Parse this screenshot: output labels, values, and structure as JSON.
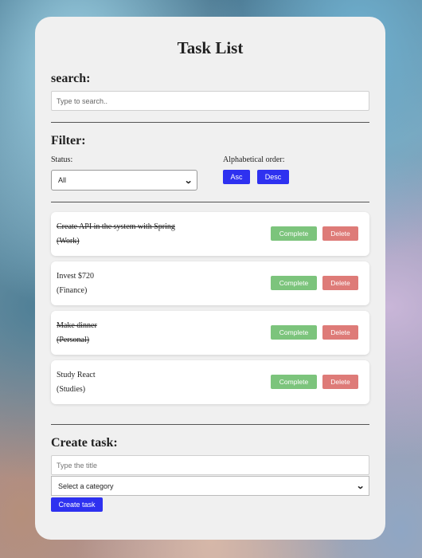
{
  "app": {
    "title": "Task List"
  },
  "search": {
    "heading": "search:",
    "placeholder": "Type to search.."
  },
  "filter": {
    "heading": "Filter:",
    "status_label": "Status:",
    "status_value": "All",
    "order_label": "Alphabetical order:",
    "asc_label": "Asc",
    "desc_label": "Desc"
  },
  "tasks": [
    {
      "title": "Create API in the system with Spring",
      "category": "(Work)",
      "completed": true
    },
    {
      "title": "Invest $720",
      "category": "(Finance)",
      "completed": false
    },
    {
      "title": "Make dinner",
      "category": "(Personal)",
      "completed": true
    },
    {
      "title": "Study React",
      "category": "(Studies)",
      "completed": false
    }
  ],
  "task_actions": {
    "complete_label": "Complete",
    "delete_label": "Delete"
  },
  "create": {
    "heading": "Create task:",
    "title_placeholder": "Type the title",
    "category_value": "Select a category",
    "button_label": "Create task"
  },
  "colors": {
    "primary_button": "#2e31f0",
    "complete_button": "#7cc47c",
    "delete_button": "#de7b78",
    "card_background": "#f0f0f0"
  }
}
